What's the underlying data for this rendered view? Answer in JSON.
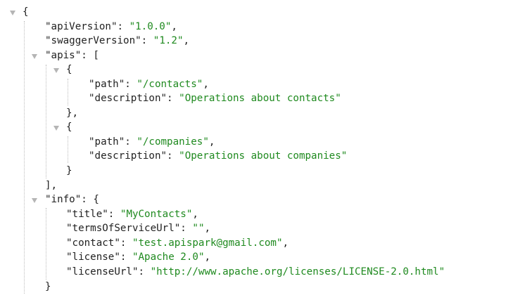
{
  "json": {
    "root_open": "{",
    "root_close": "}",
    "apiVersion": {
      "key": "apiVersion",
      "value": "1.0.0"
    },
    "swaggerVersion": {
      "key": "swaggerVersion",
      "value": "1.2"
    },
    "apis": {
      "key": "apis",
      "open": "[",
      "close": "],",
      "items": [
        {
          "open": "{",
          "close": "},",
          "path": {
            "key": "path",
            "value": "/contacts"
          },
          "description": {
            "key": "description",
            "value": "Operations about contacts"
          }
        },
        {
          "open": "{",
          "close": "}",
          "path": {
            "key": "path",
            "value": "/companies"
          },
          "description": {
            "key": "description",
            "value": "Operations about companies"
          }
        }
      ]
    },
    "info": {
      "key": "info",
      "open": "{",
      "close": "}",
      "title": {
        "key": "title",
        "value": "MyContacts"
      },
      "termsOfServiceUrl": {
        "key": "termsOfServiceUrl",
        "value": ""
      },
      "contact": {
        "key": "contact",
        "value": "test.apispark@gmail.com"
      },
      "license": {
        "key": "license",
        "value": "Apache 2.0"
      },
      "licenseUrl": {
        "key": "licenseUrl",
        "value": "http://www.apache.org/licenses/LICENSE-2.0.html"
      }
    }
  },
  "colors": {
    "string": "#1f8a1f",
    "text": "#222222",
    "toggle": "#b5b5b5",
    "guide": "#bdbdbd"
  }
}
